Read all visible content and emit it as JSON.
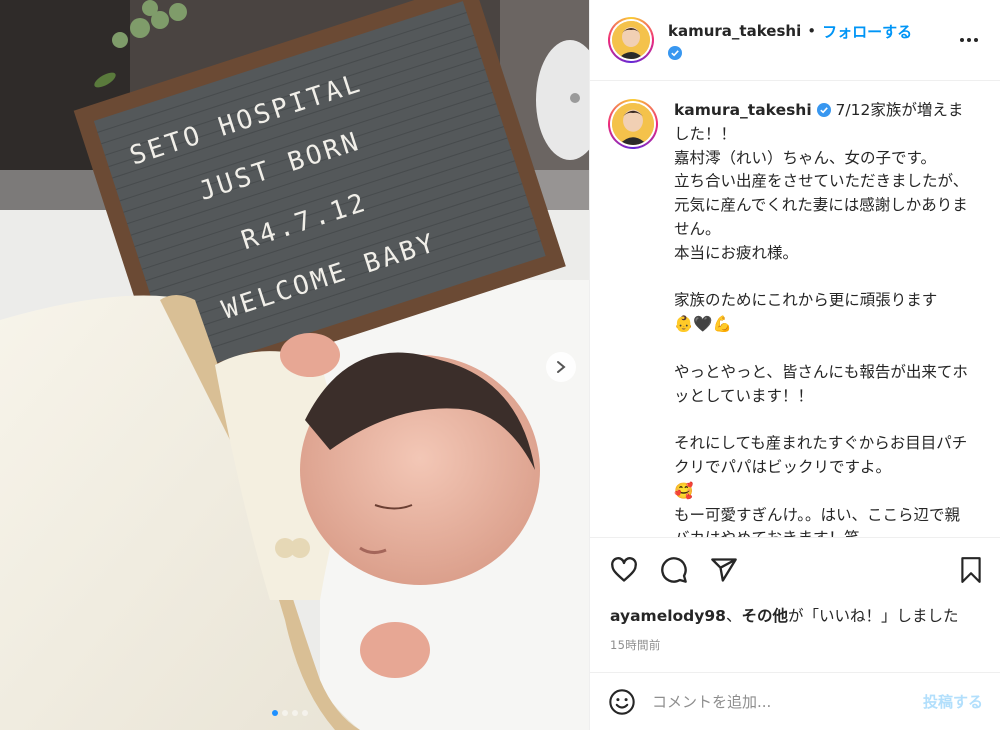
{
  "photo": {
    "letterboard_lines": [
      "SETO HOSPITAL",
      "JUST BORN",
      "R4.7.12",
      "WELCOME BABY"
    ],
    "carousel_total": 4,
    "carousel_active_index": 0
  },
  "header": {
    "username": "kamura_takeshi",
    "separator": "•",
    "follow_label": "フォローする",
    "more_icon": "ellipsis-icon"
  },
  "caption": {
    "username": "kamura_takeshi",
    "first_text": " 7/12家族が増えました！！",
    "paragraphs": [
      "嘉村澪（れい）ちゃん、女の子です。",
      "立ち合い出産をさせていただきましたが、元気に産んでくれた妻には感謝しかありません。",
      "本当にお疲れ様。",
      "",
      "家族のためにこれから更に頑張ります",
      "👶🖤💪",
      "",
      "やっとやっと、皆さんにも報告が出来てホッとしています！！",
      "",
      "それにしても産まれたすぐからお目目パチクリでパパはビックリですよ。",
      "🥰",
      "もー可愛すぎんけ。。はい、ここら辺で親バカはやめておきます！笑"
    ]
  },
  "actions": {
    "like_icon": "heart-icon",
    "comment_icon": "comment-icon",
    "share_icon": "paper-plane-icon",
    "save_icon": "bookmark-icon"
  },
  "likes": {
    "user": "ayamelody98",
    "comma": "、",
    "others": "その他",
    "suffix": "が「いいね！」しました"
  },
  "timestamp": "15時間前",
  "comment": {
    "placeholder": "コメントを追加...",
    "post_label": "投稿する",
    "emoji_icon": "smiley-icon"
  },
  "colors": {
    "link_blue": "#0095f6",
    "verified_blue": "#3897f0",
    "post_disabled": "#b2dffc",
    "muted": "#8e8e8e"
  }
}
